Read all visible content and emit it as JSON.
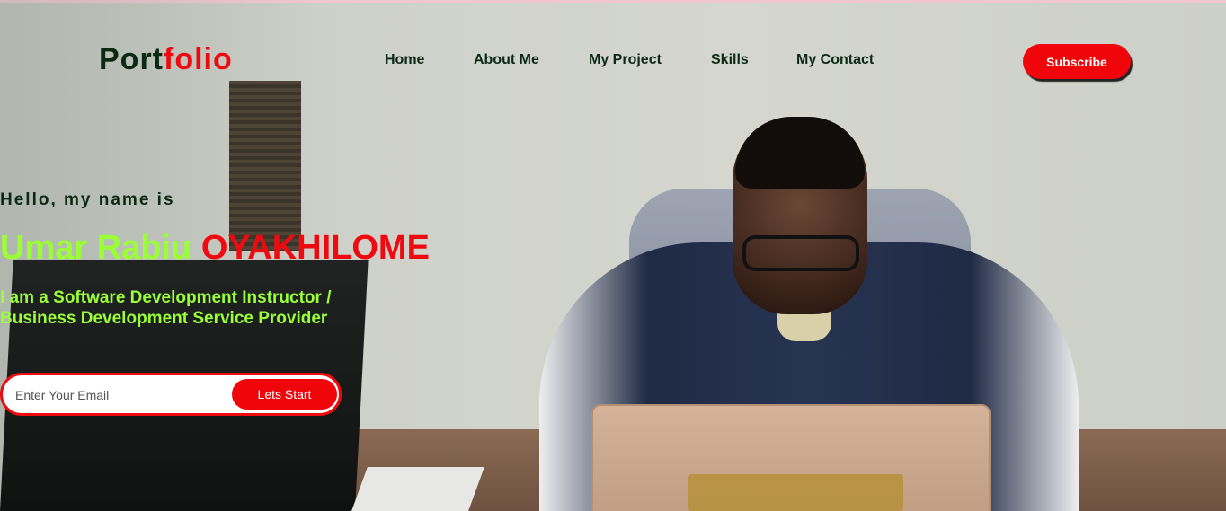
{
  "logo": {
    "main": "Port",
    "accent": "folio"
  },
  "nav": {
    "items": [
      {
        "label": "Home"
      },
      {
        "label": "About Me"
      },
      {
        "label": "My Project"
      },
      {
        "label": "Skills"
      },
      {
        "label": "My Contact"
      }
    ],
    "subscribe_label": "Subscribe"
  },
  "hero": {
    "greeting": "Hello, my name is",
    "first_name": "Umar Rabiu",
    "last_name": "OYAKHILOME",
    "role_line1": "I am a Software Development Instructor /",
    "role_line2": "Business Development Service Provider"
  },
  "email_form": {
    "placeholder": "Enter Your Email",
    "value": "",
    "button_label": "Lets Start"
  },
  "colors": {
    "accent_red": "#ee0a0f",
    "accent_green": "#9aff37",
    "dark_text": "#0b2a14"
  }
}
